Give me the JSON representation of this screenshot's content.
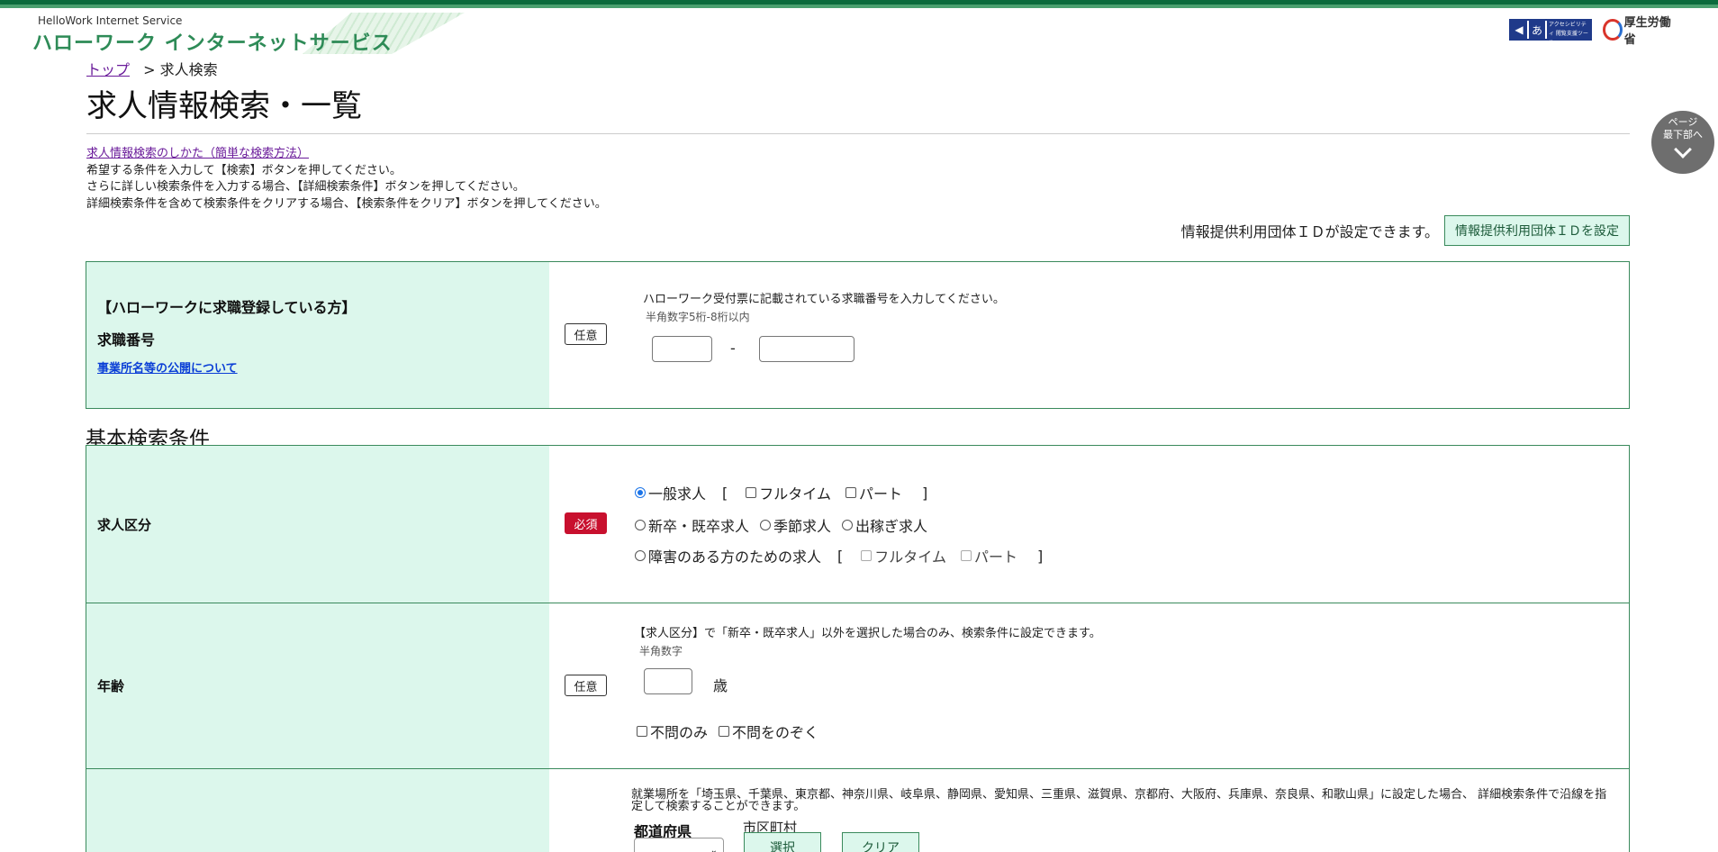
{
  "header": {
    "logo_en": "HelloWork Internet Service",
    "logo_ja": "ハローワーク インターネットサービス",
    "accessibility_badge": "アクセシビリティ 閲覧支援ツール",
    "ministry": "厚生労働省"
  },
  "breadcrumb": {
    "top": "トップ",
    "sep": ">",
    "current": "求人検索"
  },
  "page_title": "求人情報検索・一覧",
  "help": {
    "link": "求人情報検索のしかた（簡単な検索方法）",
    "line1": "希望する条件を入力して【検索】ボタンを押してください。",
    "line2": "さらに詳しい検索条件を入力する場合、【詳細検索条件】ボタンを押してください。",
    "line3": "詳細検索条件を含めて検索条件をクリアする場合、【検索条件をクリア】ボタンを押してください。"
  },
  "scroll_bottom": {
    "line1": "ページ",
    "line2": "最下部へ"
  },
  "id_setting": {
    "note": "情報提供利用団体ＩＤが設定できます。",
    "button": "情報提供利用団体ＩＤを設定"
  },
  "job_seeker": {
    "heading": "【ハローワークに求職登録している方】",
    "label": "求職番号",
    "link": "事業所名等の公開について",
    "tag": "任意",
    "instruction": "ハローワーク受付票に記載されている求職番号を入力してください。",
    "hint": "半角数字5桁-8桁以内",
    "separator": "-",
    "value1": "",
    "value2": ""
  },
  "basic_section_title": "基本検索条件",
  "job_category": {
    "label": "求人区分",
    "tag": "必須",
    "general": "一般求人",
    "fulltime": "フルタイム",
    "part": "パート",
    "new_grad": "新卒・既卒求人",
    "seasonal": "季節求人",
    "migrant": "出稼ぎ求人",
    "disabled": "障害のある方のための求人",
    "bracket_open": "[",
    "bracket_close": "]",
    "selected": "一般求人"
  },
  "age": {
    "label": "年齢",
    "tag": "任意",
    "note": "【求人区分】で「新卒・既卒求人」以外を選択した場合のみ、検索条件に設定できます。",
    "hint": "半角数字",
    "unit": "歳",
    "value": "",
    "only_unspecified": "不問のみ",
    "exclude_unspecified": "不問をのぞく"
  },
  "location": {
    "note": "就業場所を「埼玉県、千葉県、東京都、神奈川県、岐阜県、静岡県、愛知県、三重県、滋賀県、京都府、大阪府、兵庫県、奈良県、和歌山県」に設定した場合、 詳細検索条件で沿線を指定して検索することができます。",
    "prefecture_label": "都道府県",
    "city_label": "市区町村",
    "select_button": "選択",
    "clear_button": "クリア"
  },
  "colors": {
    "accent_green": "#3a8a5c",
    "panel_bg": "#dcf7ec",
    "required_red": "#c8102e"
  }
}
